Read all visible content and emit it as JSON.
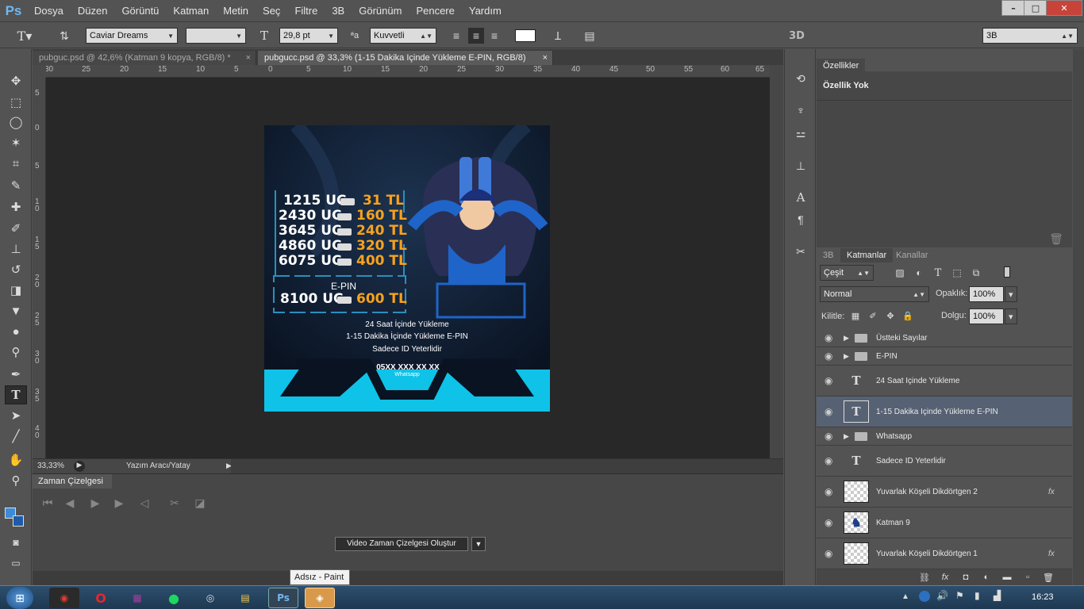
{
  "app": {
    "logo": "Ps",
    "menu": [
      "Dosya",
      "Düzen",
      "Görüntü",
      "Katman",
      "Metin",
      "Seç",
      "Filtre",
      "3B",
      "Görünüm",
      "Pencere",
      "Yardım"
    ],
    "window_controls": [
      "–",
      "□",
      "✕"
    ]
  },
  "options": {
    "font_family": "Caviar Dreams",
    "font_style": "",
    "font_size": "29,8 pt",
    "antialias": "Kuvvetli",
    "mode_3d": "3B",
    "label_3d": "3D"
  },
  "tabs": [
    {
      "label": "pubguc.psd @ 42,6% (Katman 9 kopya, RGB/8) *"
    },
    {
      "label": "pubgucc.psd @ 33,3% (1-15 Dakika Içinde Yükleme E-PIN, RGB/8)"
    }
  ],
  "ruler_h": [
    "30",
    "25",
    "20",
    "15",
    "10",
    "5",
    "0",
    "5",
    "10",
    "15",
    "20",
    "25",
    "30",
    "35",
    "40",
    "45",
    "50",
    "55",
    "60",
    "65"
  ],
  "ruler_v": [
    "5",
    "0",
    "5",
    "1 0",
    "1 5",
    "2 0",
    "2 5",
    "3 0",
    "3 5",
    "4 0"
  ],
  "status": {
    "zoom": "33,33%",
    "info": "Yazım Aracı/Yatay"
  },
  "timeline": {
    "title": "Zaman Çizelgesi",
    "create_button": "Video Zaman Çizelgesi Oluştur"
  },
  "tooltip": "Adsız - Paint",
  "properties": {
    "tab": "Özellikler",
    "content": "Özellik Yok"
  },
  "layers_panel": {
    "tabs": [
      "3B",
      "Katmanlar",
      "Kanallar"
    ],
    "filter": "Çeşit",
    "blend_mode": "Normal",
    "opacity_label": "Opaklık:",
    "opacity": "100%",
    "lock_label": "Kilitle:",
    "fill_label": "Dolgu:",
    "fill": "100%",
    "layers": [
      {
        "name": "Üstteki Sayılar",
        "type": "group",
        "selected": false
      },
      {
        "name": "E-PIN",
        "type": "group",
        "selected": false
      },
      {
        "name": "24 Saat Içinde Yükleme",
        "type": "text",
        "selected": false
      },
      {
        "name": "1-15 Dakika Içinde Yükleme E-PIN",
        "type": "text",
        "selected": true
      },
      {
        "name": "Whatsapp",
        "type": "group",
        "selected": false
      },
      {
        "name": "Sadece ID Yeterlidir",
        "type": "text",
        "selected": false
      },
      {
        "name": "Yuvarlak Köşeli Dikdörtgen 2",
        "type": "shape",
        "fx": "fx",
        "selected": false
      },
      {
        "name": "Katman 9",
        "type": "image",
        "selected": false
      },
      {
        "name": "Yuvarlak Köşeli Dikdörtgen 1",
        "type": "shape",
        "fx": "fx",
        "selected": false
      }
    ]
  },
  "artwork": {
    "prices": [
      [
        "1215 UC",
        "31 TL"
      ],
      [
        "2430 UC",
        "160 TL"
      ],
      [
        "3645 UC",
        "240 TL"
      ],
      [
        "4860 UC",
        "320 TL"
      ],
      [
        "6075 UC",
        "400 TL"
      ]
    ],
    "epin_label": "E-PIN",
    "epin_price": [
      "8100 UC",
      "600 TL"
    ],
    "line1": "24 Saat İçinde Yükleme",
    "line2": "1-15 Dakika İçinde Yükleme E-PIN",
    "line3": "Sadece ID Yeterlidir",
    "phone": "05XX XXX XX XX",
    "whatsapp": "Whatsapp"
  },
  "clock": "16:23",
  "colors": {
    "accent": "#1fd3f0",
    "price_orange": "#f7a21c",
    "selected_layer": "#566173"
  }
}
